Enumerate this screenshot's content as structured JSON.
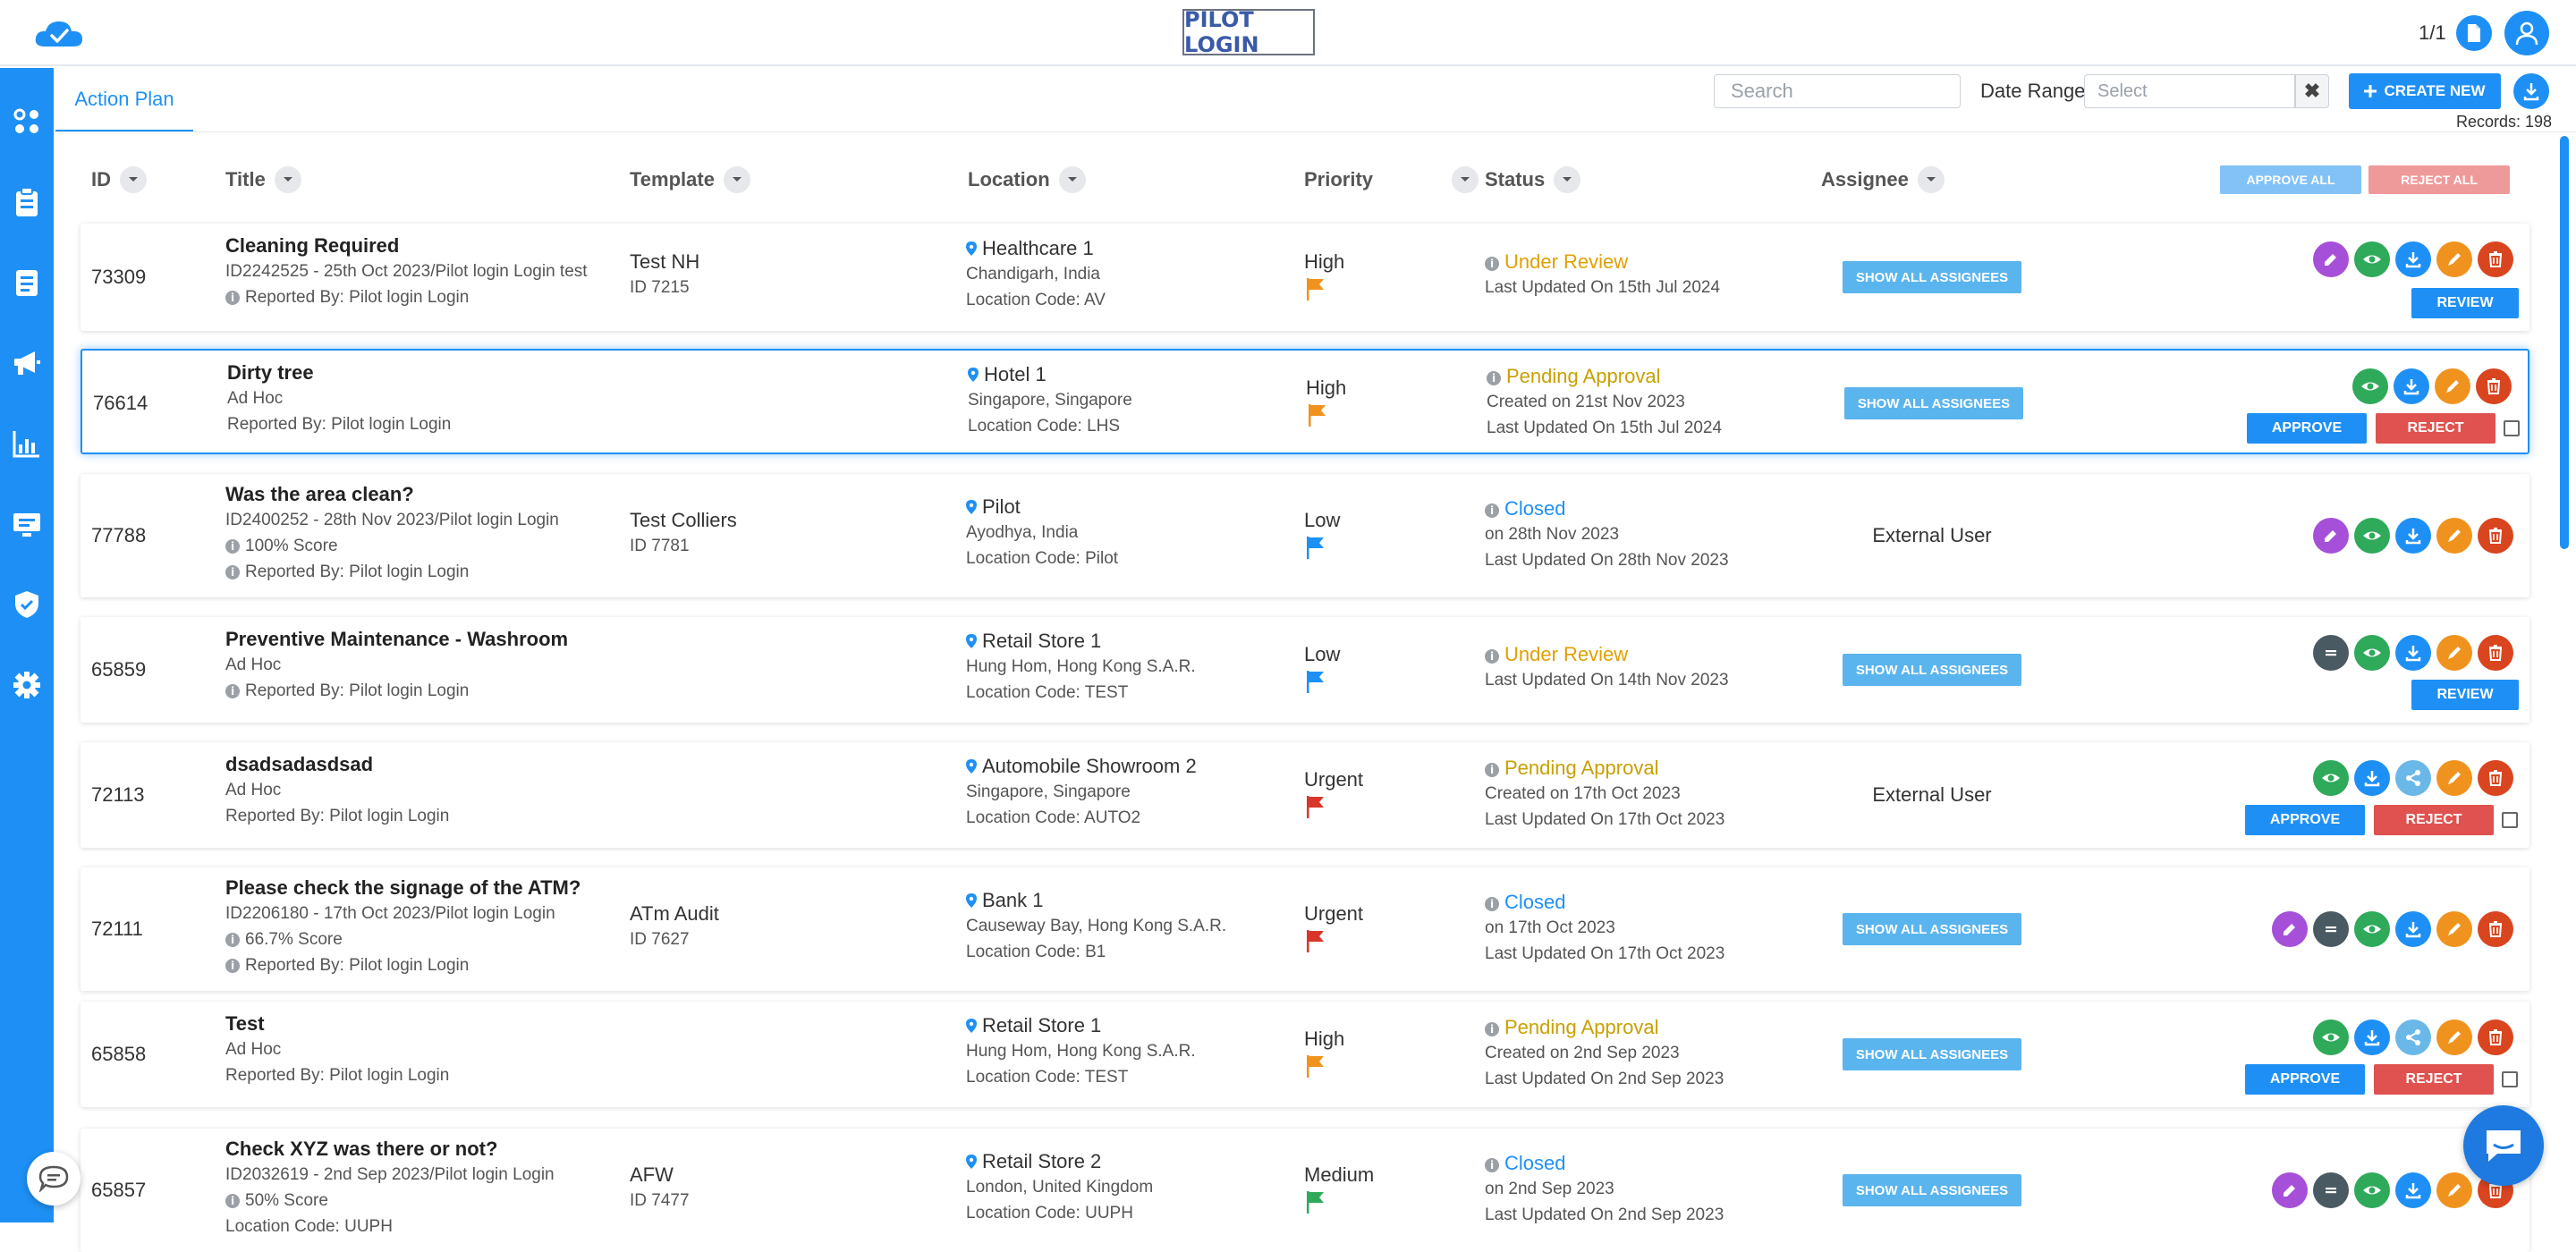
{
  "header": {
    "brand": "PILOT LOGIN",
    "page_count": "1/1"
  },
  "subheader": {
    "tab_label": "Action Plan",
    "search_placeholder": "Search",
    "date_range_label": "Date Range",
    "date_placeholder": "Select",
    "clear_symbol": "✖",
    "create_label": "CREATE NEW",
    "records": "Records: 198"
  },
  "table": {
    "columns": {
      "id": "ID",
      "title": "Title",
      "template": "Template",
      "location": "Location",
      "priority": "Priority",
      "status": "Status",
      "assignee": "Assignee"
    },
    "approve_all": "APPROVE ALL",
    "reject_all": "REJECT ALL",
    "show_all_label": "SHOW ALL ASSIGNEES",
    "review_label": "REVIEW",
    "approve_label": "APPROVE",
    "reject_label": "REJECT",
    "rows": [
      {
        "id": "73309",
        "title": "Cleaning Required",
        "line2": "ID2242525 - 25th Oct 2023/Pilot login Login test",
        "line3": "Reported By: Pilot login Login",
        "template": "Test NH",
        "template_id": "ID 7215",
        "location": "Healthcare 1",
        "city": "Chandigarh, India",
        "code": "Location Code: AV",
        "priority": "High",
        "status": "Under Review",
        "status_l2": "Last Updated On 15th Jul 2024",
        "status_l3": "",
        "assignee": ""
      },
      {
        "id": "76614",
        "title": "Dirty tree",
        "line2": "Ad Hoc",
        "line3": "Reported By: Pilot login Login",
        "template": "",
        "template_id": "",
        "location": "Hotel 1",
        "city": "Singapore, Singapore",
        "code": "Location Code: LHS",
        "priority": "High",
        "status": "Pending Approval",
        "status_l2": "Created on 21st Nov 2023",
        "status_l3": "Last Updated On 15th Jul 2024",
        "assignee": ""
      },
      {
        "id": "77788",
        "title": "Was the area clean?",
        "line2": "ID2400252 - 28th Nov 2023/Pilot login Login",
        "line3": "100% Score",
        "line4": "Reported By: Pilot login Login",
        "template": "Test Colliers",
        "template_id": "ID 7781",
        "location": "Pilot",
        "city": "Ayodhya, India",
        "code": "Location Code: Pilot",
        "priority": "Low",
        "status": "Closed",
        "status_l2": "on 28th Nov 2023",
        "status_l3": "Last Updated On 28th Nov 2023",
        "assignee": "External User"
      },
      {
        "id": "65859",
        "title": "Preventive Maintenance - Washroom",
        "line2": "Ad Hoc",
        "line3": "Reported By: Pilot login Login",
        "template": "",
        "template_id": "",
        "location": "Retail Store 1",
        "city": "Hung Hom, Hong Kong S.A.R.",
        "code": "Location Code: TEST",
        "priority": "Low",
        "status": "Under Review",
        "status_l2": "Last Updated On 14th Nov 2023",
        "status_l3": "",
        "assignee": ""
      },
      {
        "id": "72113",
        "title": "dsadsadasdsad",
        "line2": "Ad Hoc",
        "line3": "Reported By: Pilot login Login",
        "template": "",
        "template_id": "",
        "location": "Automobile Showroom 2",
        "city": "Singapore, Singapore",
        "code": "Location Code: AUTO2",
        "priority": "Urgent",
        "status": "Pending Approval",
        "status_l2": "Created on 17th Oct 2023",
        "status_l3": "Last Updated On 17th Oct 2023",
        "assignee": "External User"
      },
      {
        "id": "72111",
        "title": "Please check the signage of the ATM?",
        "line2": "ID2206180 - 17th Oct 2023/Pilot login Login",
        "line3": "66.7% Score",
        "line4": "Reported By: Pilot login Login",
        "template": "ATm Audit",
        "template_id": "ID 7627",
        "location": "Bank 1",
        "city": "Causeway Bay, Hong Kong S.A.R.",
        "code": "Location Code: B1",
        "priority": "Urgent",
        "status": "Closed",
        "status_l2": "on 17th Oct 2023",
        "status_l3": "Last Updated On 17th Oct 2023",
        "assignee": ""
      },
      {
        "id": "65858",
        "title": "Test",
        "line2": "Ad Hoc",
        "line3": "Reported By: Pilot login Login",
        "template": "",
        "template_id": "",
        "location": "Retail Store 1",
        "city": "Hung Hom, Hong Kong S.A.R.",
        "code": "Location Code: TEST",
        "priority": "High",
        "status": "Pending Approval",
        "status_l2": "Created on 2nd Sep 2023",
        "status_l3": "Last Updated On 2nd Sep 2023",
        "assignee": ""
      },
      {
        "id": "65857",
        "title": "Check XYZ was there or not?",
        "line2": "ID2032619 - 2nd Sep 2023/Pilot login Login",
        "line3": "50% Score",
        "line4": "Location Code: UUPH",
        "template": "AFW",
        "template_id": "ID 7477",
        "location": "Retail Store 2",
        "city": "London, United Kingdom",
        "code": "Location Code: UUPH",
        "priority": "Medium",
        "status": "Closed",
        "status_l2": "on 2nd Sep 2023",
        "status_l3": "Last Updated On 2nd Sep 2023",
        "assignee": ""
      }
    ]
  },
  "colors": {
    "accent": "#1e90f5",
    "under_review": "#e0a000",
    "pending": "#c8a000",
    "closed": "#1e90f5",
    "flag_high": "#f0931e",
    "flag_low": "#1e90f5",
    "flag_urgent": "#d9362b",
    "flag_medium": "#2eaa5a",
    "edit": "#a64fd9",
    "view": "#2eaa5a",
    "download": "#1e90f5",
    "pen": "#f0931e",
    "delete": "#d9451f",
    "note": "#4a5a62",
    "share": "#6ab8e8"
  }
}
